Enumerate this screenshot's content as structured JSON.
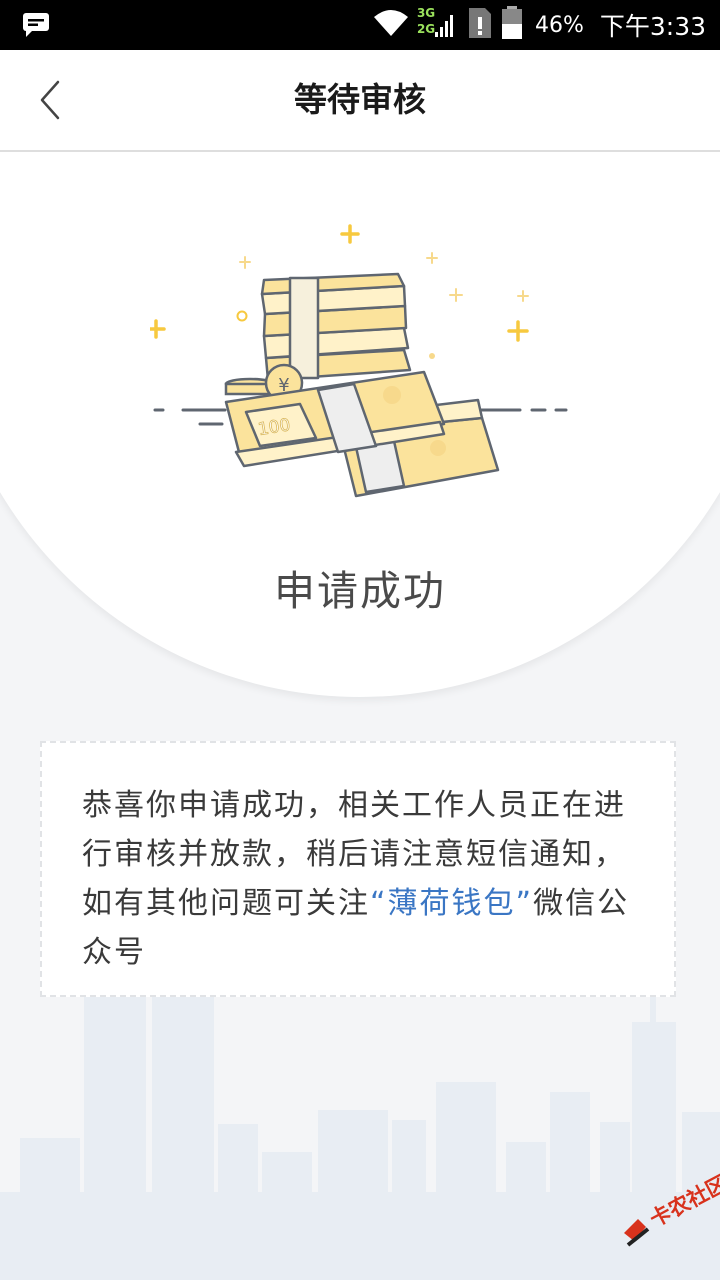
{
  "status_bar": {
    "network_top": "3G",
    "network_bottom": "2G",
    "battery_percent": "46%",
    "time": "下午3:33"
  },
  "nav": {
    "title": "等待审核"
  },
  "hero": {
    "bill_label": "100",
    "coin_symbol": "¥",
    "status_title": "申请成功"
  },
  "message": {
    "text_before": "恭喜你申请成功，相关工作人员正在进行审核并放款，稍后请注意短信通知，如有其他问题可关注",
    "highlight": "“薄荷钱包”",
    "text_after": "微信公众号"
  },
  "watermark": {
    "text": "卡农社区"
  },
  "colors": {
    "link": "#3a76c4",
    "money_fill": "#fbe39c",
    "money_stroke": "#5f6670",
    "sparkle": "#f7c93f"
  }
}
